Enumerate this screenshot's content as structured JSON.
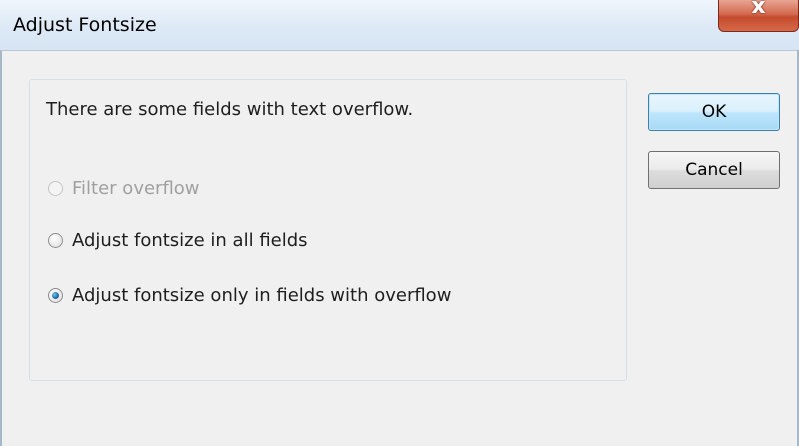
{
  "window": {
    "title": "Adjust Fontsize",
    "close_glyph": "x",
    "close_color": "#c44a2c"
  },
  "dialog": {
    "message": "There are some fields with text overflow.",
    "options": [
      {
        "label": "Filter overflow",
        "enabled": false,
        "selected": false
      },
      {
        "label": "Adjust fontsize in all fields",
        "enabled": true,
        "selected": false
      },
      {
        "label": "Adjust fontsize only in fields with overflow",
        "enabled": true,
        "selected": true
      }
    ]
  },
  "buttons": {
    "ok_label": "OK",
    "cancel_label": "Cancel"
  }
}
